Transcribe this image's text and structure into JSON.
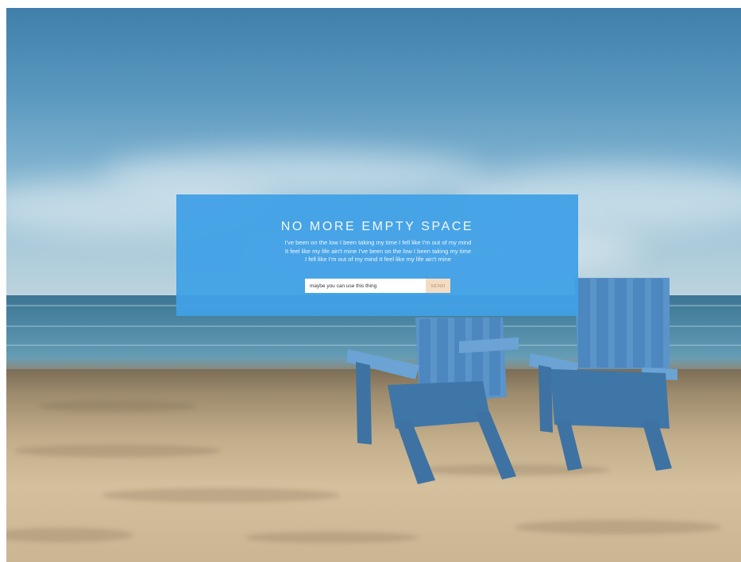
{
  "hero": {
    "title": "NO MORE EMPTY SPACE",
    "text": "I've been on the low I been taking my time I fell like I'm out of my mind It feel like my life ain't mine I've been on the low I been taking my time I fell like I'm out of my mind It feel like my life ain't mine"
  },
  "form": {
    "input_value": "maybe you can use this thing",
    "send_label": "SEND"
  },
  "colors": {
    "card_background": "#40a0e6",
    "send_button": "#f4dcc3",
    "send_text": "#b08a63"
  },
  "background": {
    "image": "beach-with-two-blue-chairs"
  }
}
